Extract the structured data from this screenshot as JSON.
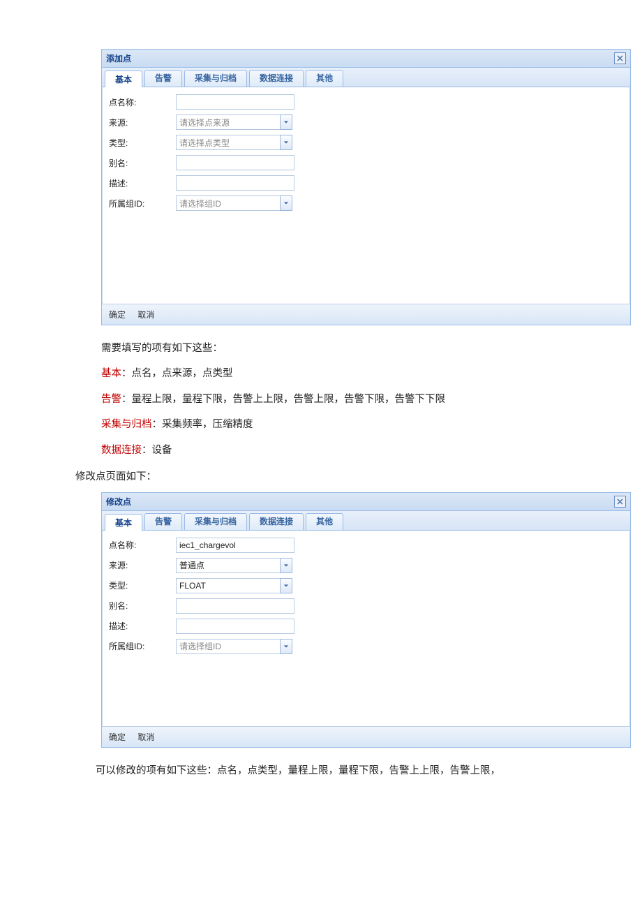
{
  "dialog1": {
    "title": "添加点",
    "tabs": [
      "基本",
      "告警",
      "采集与归档",
      "数据连接",
      "其他"
    ],
    "fields": {
      "name_label": "点名称:",
      "name_value": "",
      "source_label": "来源:",
      "source_value": "请选择点来源",
      "type_label": "类型:",
      "type_value": "请选择点类型",
      "alias_label": "别名:",
      "alias_value": "",
      "desc_label": "描述:",
      "desc_value": "",
      "group_label": "所属组ID:",
      "group_value": "请选择组ID"
    },
    "ok": "确定",
    "cancel": "取消"
  },
  "prose1": {
    "intro": "需要填写的项有如下这些：",
    "l1_head": "基本",
    "l1_rest": "：点名，点来源，点类型",
    "l2_head": "告警",
    "l2_rest": "：量程上限，量程下限，告警上上限，告警上限，告警下限，告警下下限",
    "l3_head": "采集与归档",
    "l3_rest": "：采集频率，压缩精度",
    "l4_head": "数据连接",
    "l4_rest": "：设备"
  },
  "prose_mid": "修改点页面如下：",
  "dialog2": {
    "title": "修改点",
    "tabs": [
      "基本",
      "告警",
      "采集与归档",
      "数据连接",
      "其他"
    ],
    "fields": {
      "name_label": "点名称:",
      "name_value": "iec1_chargevol",
      "source_label": "来源:",
      "source_value": "普通点",
      "type_label": "类型:",
      "type_value": "FLOAT",
      "alias_label": "别名:",
      "alias_value": "",
      "desc_label": "描述:",
      "desc_value": "",
      "group_label": "所属组ID:",
      "group_value": "请选择组ID"
    },
    "ok": "确定",
    "cancel": "取消"
  },
  "prose2": "可以修改的项有如下这些：点名，点类型，量程上限，量程下限，告警上上限，告警上限，"
}
